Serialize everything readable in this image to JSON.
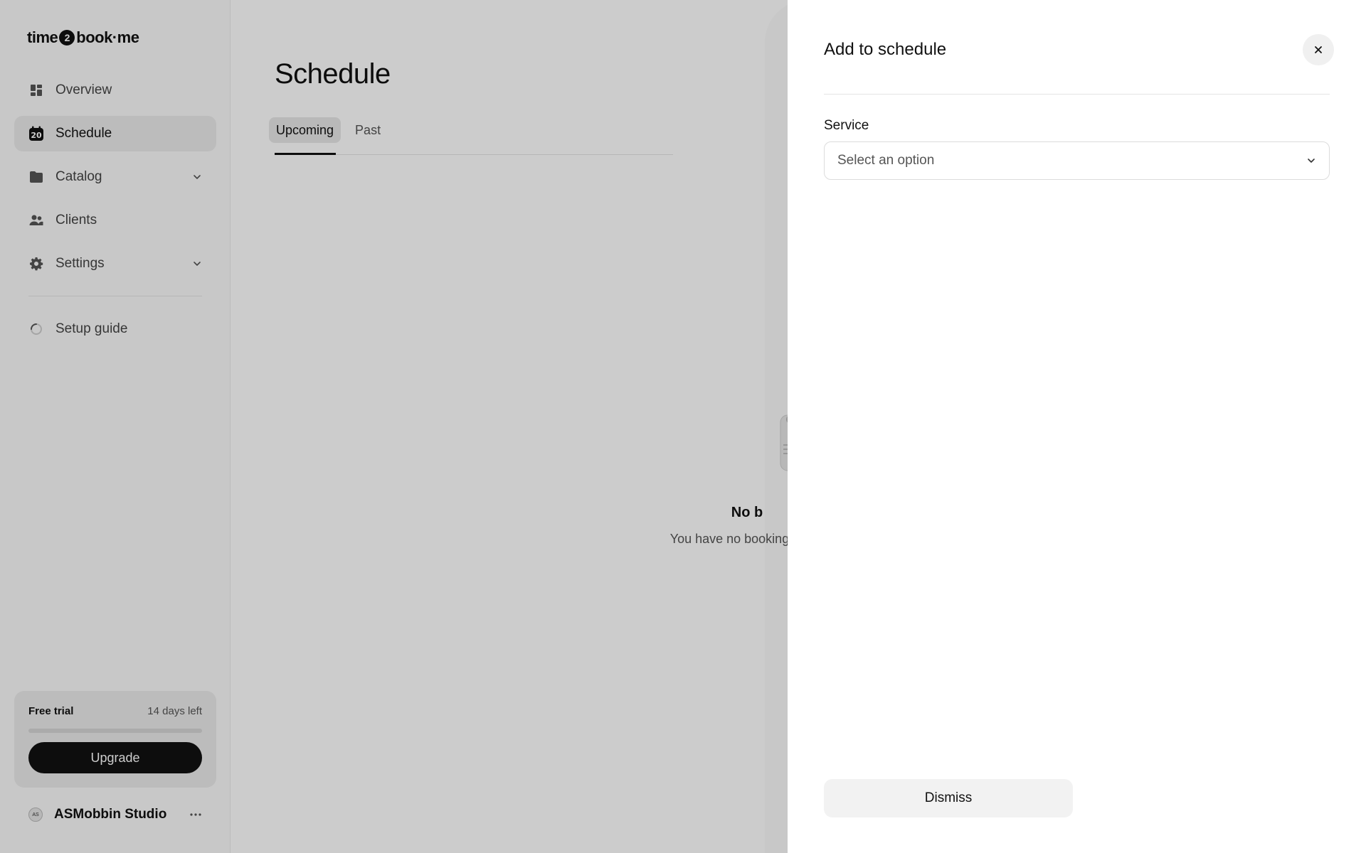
{
  "app": {
    "logo_part1": "time",
    "logo_badge": "2",
    "logo_part2": "book·me"
  },
  "sidebar": {
    "items": [
      {
        "label": "Overview",
        "icon": "grid-icon"
      },
      {
        "label": "Schedule",
        "icon": "calendar-20-icon",
        "active": true
      },
      {
        "label": "Catalog",
        "icon": "folder-icon",
        "expandable": true
      },
      {
        "label": "Clients",
        "icon": "users-icon"
      },
      {
        "label": "Settings",
        "icon": "gear-icon",
        "expandable": true
      }
    ],
    "setup_guide": {
      "label": "Setup guide",
      "icon": "progress-spinner-icon"
    },
    "calendar_badge": "20"
  },
  "trial": {
    "title": "Free trial",
    "days_left": "14 days left",
    "progress_fraction": 0.0,
    "upgrade_label": "Upgrade"
  },
  "account": {
    "name": "ASMobbin Studio",
    "avatar_text": "AS"
  },
  "main": {
    "title": "Schedule",
    "tabs": [
      {
        "label": "Upcoming",
        "active": true
      },
      {
        "label": "Past"
      }
    ],
    "empty": {
      "title": "No b",
      "description": "You have no bookings. You"
    }
  },
  "drawer": {
    "title": "Add to schedule",
    "field_label": "Service",
    "select_placeholder": "Select an option",
    "dismiss_label": "Dismiss"
  },
  "colors": {
    "accent": "#111111",
    "overlay": "rgba(0,0,0,0.2)",
    "active_nav_bg": "#ececec"
  }
}
